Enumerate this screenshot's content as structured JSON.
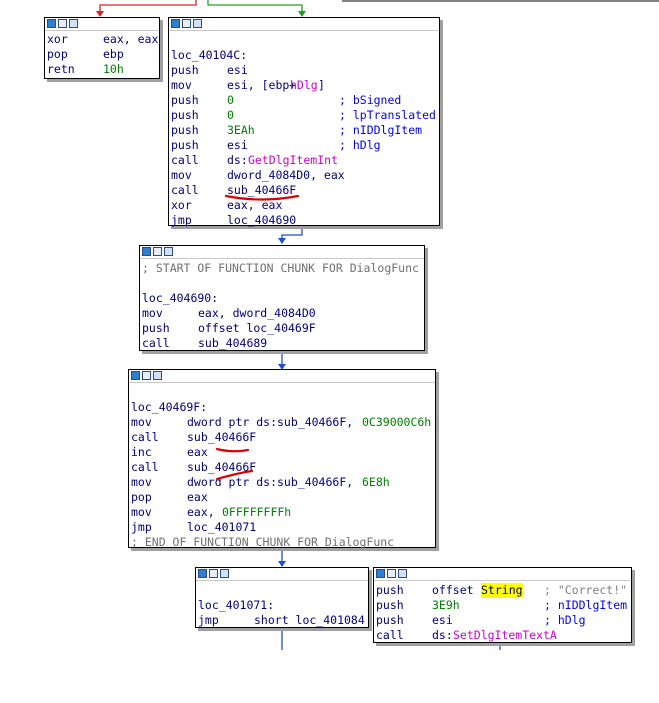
{
  "nodes": {
    "n1": {
      "lines": [
        {
          "mn": "xor",
          "op": "eax, eax"
        },
        {
          "mn": "pop",
          "op": "ebp"
        },
        {
          "mn": "retn",
          "num": "10h"
        }
      ]
    },
    "n2": {
      "label": "loc_40104C:",
      "lines": [
        {
          "mn": "push",
          "op": "esi"
        },
        {
          "mn": "mov",
          "op": "esi, [ebp+",
          "var": "hDlg",
          "op2": "]"
        },
        {
          "mn": "push",
          "num": "0",
          "cmt": "; bSigned"
        },
        {
          "mn": "push",
          "num": "0",
          "cmt": "; lpTranslated"
        },
        {
          "mn": "push",
          "num": "3EAh",
          "cmt": "; nIDDlgItem"
        },
        {
          "mn": "push",
          "op": "esi",
          "cmt": "; hDlg"
        },
        {
          "mn": "call",
          "op": "ds:",
          "func": "GetDlgItemInt"
        },
        {
          "mn": "mov",
          "op": "dword_4084D0, eax"
        },
        {
          "mn": "call",
          "op": "sub_40466F"
        },
        {
          "mn": "xor",
          "op": "eax, eax"
        },
        {
          "mn": "jmp",
          "op": "loc_404690"
        }
      ]
    },
    "n3": {
      "chunk_start": "; START OF FUNCTION CHUNK FOR DialogFunc",
      "label": "loc_404690:",
      "lines": [
        {
          "mn": "mov",
          "op": "eax, dword_4084D0"
        },
        {
          "mn": "push",
          "op": "offset loc_40469F"
        },
        {
          "mn": "call",
          "op": "sub_404689"
        }
      ]
    },
    "n4": {
      "label": "loc_40469F:",
      "lines": [
        {
          "mn": "mov",
          "op": "dword ptr ds:sub_40466F, ",
          "num": "0C39000C6h"
        },
        {
          "mn": "call",
          "op": "sub_40466F"
        },
        {
          "mn": "inc",
          "op": "eax"
        },
        {
          "mn": "call",
          "op": "sub_40466F"
        },
        {
          "mn": "mov",
          "op": "dword ptr ds:sub_40466F, ",
          "num": "6E8h"
        },
        {
          "mn": "pop",
          "op": "eax"
        },
        {
          "mn": "mov",
          "op": "eax, ",
          "num": "0FFFFFFFFh"
        },
        {
          "mn": "jmp",
          "op": "loc_401071"
        }
      ],
      "chunk_end": "; END OF FUNCTION CHUNK FOR DialogFunc"
    },
    "n5": {
      "label": "loc_401071:",
      "lines": [
        {
          "mn": "jmp",
          "op": "short loc_401084"
        }
      ]
    },
    "n6": {
      "lines": [
        {
          "mn": "push",
          "op": "offset ",
          "hl": "String",
          "str": "; \"Correct!\""
        },
        {
          "mn": "push",
          "num": "3E9h",
          "cmt": "; nIDDlgItem"
        },
        {
          "mn": "push",
          "op": "esi",
          "cmt": "; hDlg"
        },
        {
          "mn": "call",
          "op": "ds:",
          "func": "SetDlgItemTextA"
        }
      ]
    }
  },
  "colors": {
    "edge_false": "#e02020",
    "edge_true": "#20a020",
    "edge_uncond": "#1c4fd6",
    "annotation": "#e00000"
  }
}
